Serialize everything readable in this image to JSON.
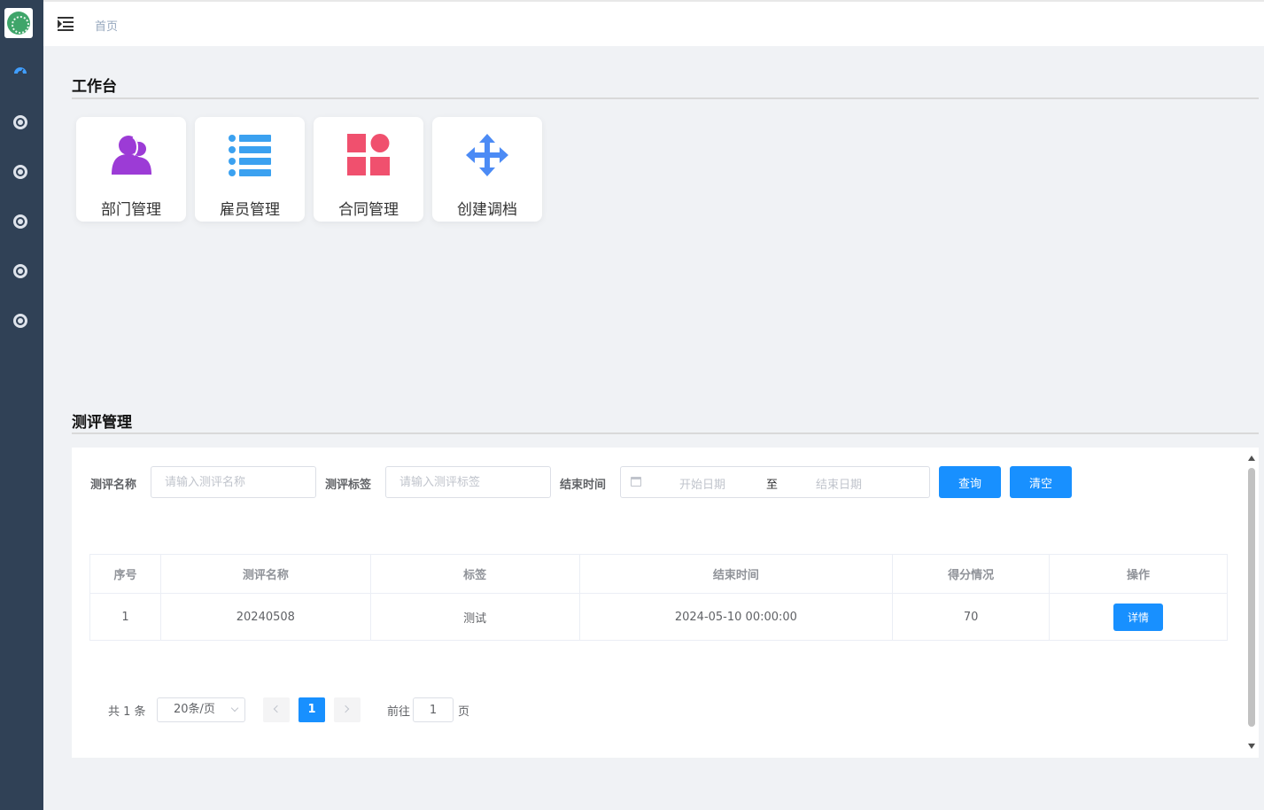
{
  "header": {
    "breadcrumb": "首页"
  },
  "workbench": {
    "title": "工作台",
    "cards": [
      {
        "label": "部门管理",
        "icon": "users-icon",
        "color": "#9c3bd6"
      },
      {
        "label": "雇员管理",
        "icon": "list-icon",
        "color": "#3ba1f0"
      },
      {
        "label": "合同管理",
        "icon": "apps-icon",
        "color": "#f0506e"
      },
      {
        "label": "创建调档",
        "icon": "move-arrows-icon",
        "color": "#4c8bf5"
      }
    ]
  },
  "evaluation": {
    "title": "测评管理",
    "filters": {
      "name_label": "测评名称",
      "name_placeholder": "请输入测评名称",
      "tag_label": "测评标签",
      "tag_placeholder": "请输入测评标签",
      "end_label": "结束时间",
      "start_placeholder": "开始日期",
      "range_separator": "至",
      "end_placeholder": "结束日期",
      "query_button": "查询",
      "clear_button": "清空"
    },
    "table": {
      "columns": [
        "序号",
        "测评名称",
        "标签",
        "结束时间",
        "得分情况",
        "操作"
      ],
      "rows": [
        {
          "index": "1",
          "name": "20240508",
          "tag": "测试",
          "end_time": "2024-05-10 00:00:00",
          "score": "70",
          "action": "详情"
        }
      ]
    },
    "pagination": {
      "total": "共 1 条",
      "page_size": "20条/页",
      "current_page": "1",
      "goto_label": "前往",
      "goto_value": "1",
      "page_suffix": "页"
    }
  },
  "colors": {
    "sidebar": "#304156",
    "primary": "#1890ff",
    "background": "#f0f2f5"
  }
}
